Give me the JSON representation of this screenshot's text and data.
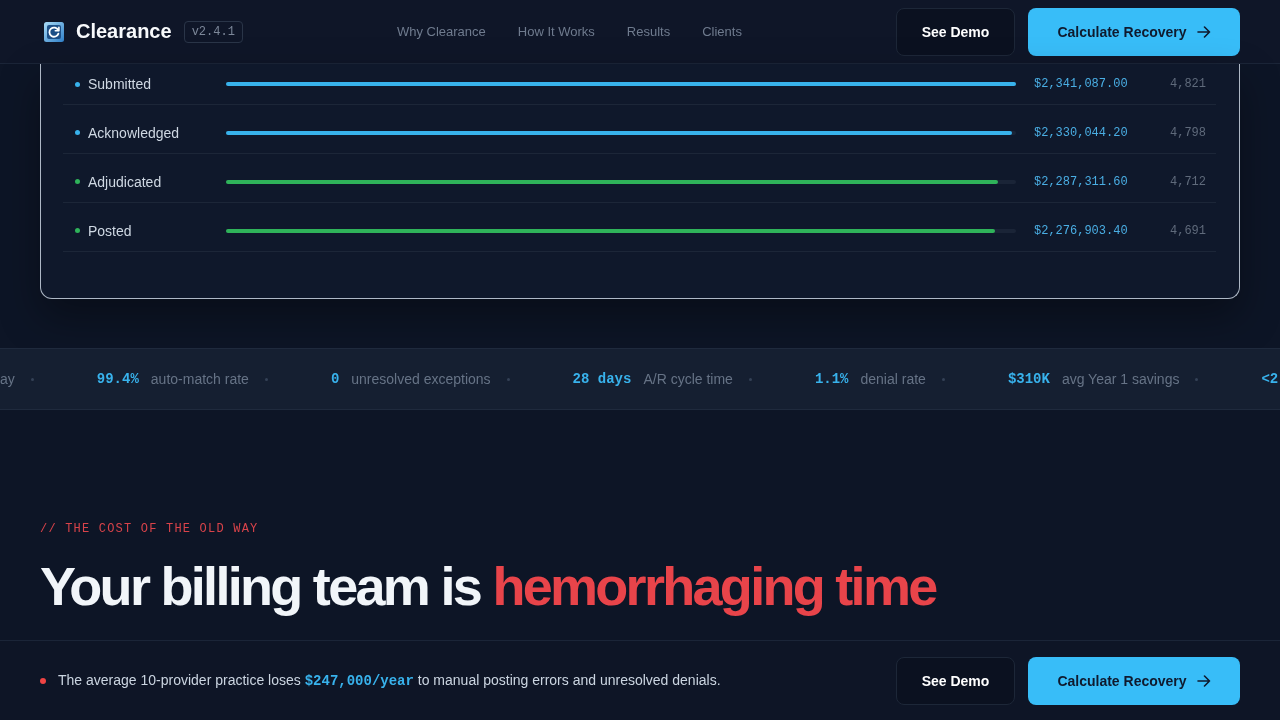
{
  "header": {
    "brand": "Clearance",
    "version": "v2.4.1",
    "nav": [
      "Why Clearance",
      "How It Works",
      "Results",
      "Clients"
    ],
    "buttons": [
      {
        "label": "See Demo",
        "kind": "secondary"
      },
      {
        "label": "Calculate Recovery",
        "kind": "primary"
      }
    ]
  },
  "pipeline": {
    "rows": [
      {
        "label": "Submitted",
        "color": "#38b2ec",
        "level": 1.0,
        "amount": "$2,341,087.00",
        "count": "4,821"
      },
      {
        "label": "Acknowledged",
        "color": "#38b2ec",
        "level": 0.995,
        "amount": "$2,330,044.20",
        "count": "4,798"
      },
      {
        "label": "Adjudicated",
        "color": "#2fb35a",
        "level": 0.977,
        "amount": "$2,287,311.60",
        "count": "4,712"
      },
      {
        "label": "Posted",
        "color": "#2fb35a",
        "level": 0.973,
        "amount": "$2,276,903.40",
        "count": "4,691"
      }
    ]
  },
  "ticker": [
    {
      "label": "ay"
    },
    {
      "value": "99.4%",
      "label": "auto-match rate"
    },
    {
      "value": "0",
      "label": "unresolved exceptions"
    },
    {
      "value": "28 days",
      "label": "A/R cycle time"
    },
    {
      "value": "1.1%",
      "label": "denial rate"
    },
    {
      "value": "$310K",
      "label": "avg Year 1 savings"
    },
    {
      "value": "<2"
    }
  ],
  "section": {
    "eyebrow": "// THE COST OF THE OLD WAY",
    "headline": [
      {
        "text": "Your billing team is",
        "accent": false
      },
      {
        "text": "hemorrhaging time",
        "accent": true
      }
    ]
  },
  "cta_bar": {
    "message": "The average 10-provider practice loses **$247,000/year** to manual posting errors and unresolved denials.",
    "buttons": [
      {
        "label": "See Demo",
        "kind": "secondary"
      },
      {
        "label": "Calculate Recovery",
        "kind": "primary"
      }
    ]
  }
}
